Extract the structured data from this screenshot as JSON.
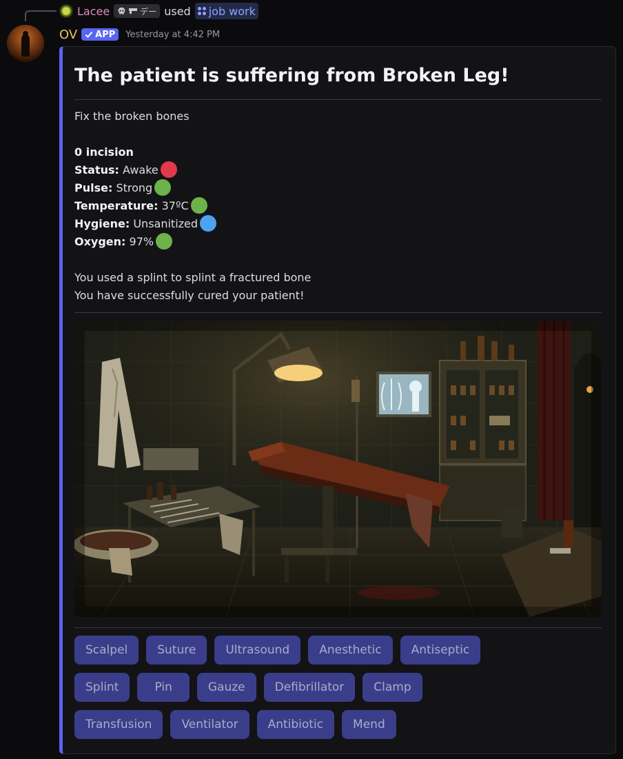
{
  "reply": {
    "name": "Lacee",
    "clan_tag": "デー",
    "used_text": "used",
    "command": "job work"
  },
  "message": {
    "author": "OV",
    "badge": "APP",
    "timestamp": "Yesterday at 4:42 PM"
  },
  "embed": {
    "accent_color": "#5865f2",
    "title": "The patient is suffering from Broken Leg!",
    "subtitle": "Fix the broken bones",
    "incision": "0 incision",
    "stats": [
      {
        "label": "Status:",
        "value": "Awake",
        "color": "#e23a4a"
      },
      {
        "label": "Pulse:",
        "value": "Strong",
        "color": "#6db24a"
      },
      {
        "label": "Temperature:",
        "value": "37ºC",
        "color": "#6db24a"
      },
      {
        "label": "Hygiene:",
        "value": "Unsanitized",
        "color": "#4da3f0"
      },
      {
        "label": "Oxygen:",
        "value": "97%",
        "color": "#6db24a"
      }
    ],
    "result_lines": [
      "You used a splint to splint a fractured bone",
      "You have successfully cured your patient!"
    ]
  },
  "buttons": [
    [
      "Scalpel",
      "Suture",
      "Ultrasound",
      "Anesthetic",
      "Antiseptic"
    ],
    [
      "Splint",
      "Pin",
      "Gauze",
      "Defibrillator",
      "Clamp"
    ],
    [
      "Transfusion",
      "Ventilator",
      "Antibiotic",
      "Mend"
    ]
  ]
}
